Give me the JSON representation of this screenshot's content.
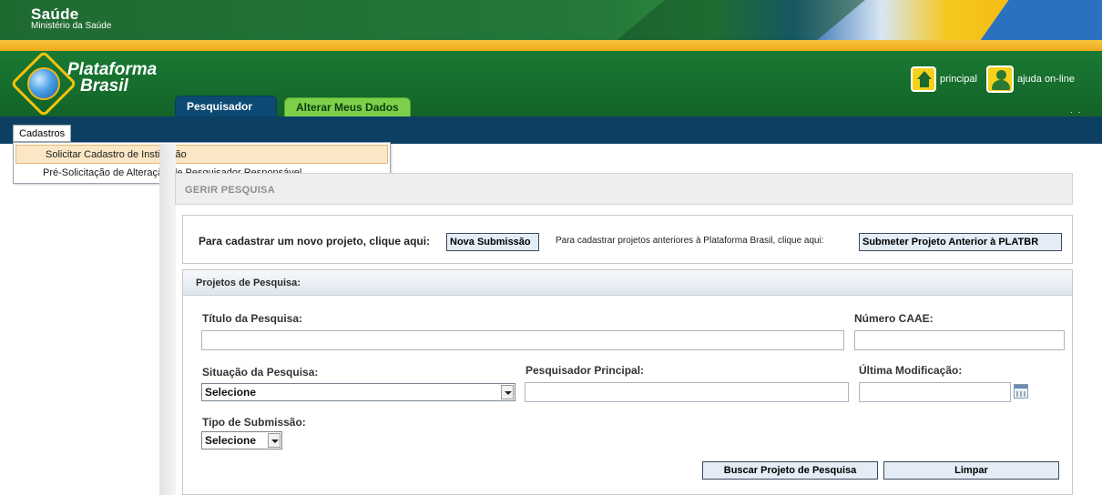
{
  "gov_bar": {
    "title": "Saúde",
    "subtitle": "Ministério da Saúde"
  },
  "logo": {
    "line1": "Plataforma",
    "line2": "Brasil"
  },
  "top_links": {
    "home": "principal",
    "help": "ajuda on-line"
  },
  "tabs": [
    {
      "label": "Pesquisador",
      "active": true
    },
    {
      "label": "Alterar Meus Dados",
      "active": false
    }
  ],
  "menu": {
    "label": "Cadastros",
    "items": [
      {
        "label": "Solicitar Cadastro de Instituição",
        "highlighted": true
      },
      {
        "label": "Pré-Solicitação de Alteração de Pesquisador Responsável",
        "highlighted": false
      }
    ]
  },
  "gerir": {
    "title": "GERIR PESQUISA"
  },
  "submission": {
    "text_new": "Para cadastrar um novo projeto, clique aqui:",
    "btn_new": "Nova Submissão",
    "text_old": "Para cadastrar projetos anteriores à Plataforma Brasil, clique aqui:",
    "btn_old": "Submeter Projeto Anterior à PLATBR"
  },
  "projects": {
    "header": "Projetos de Pesquisa:",
    "fields": {
      "titulo": {
        "label": "Título da Pesquisa:",
        "value": ""
      },
      "caae": {
        "label": "Número CAAE:",
        "value": ""
      },
      "situacao": {
        "label": "Situação da Pesquisa:",
        "value": "Selecione"
      },
      "pesquisador": {
        "label": "Pesquisador Principal:",
        "value": ""
      },
      "modificacao": {
        "label": "Última Modificação:",
        "value": ""
      },
      "tipo": {
        "label": "Tipo de Submissão:",
        "value": "Selecione"
      }
    },
    "buttons": {
      "search": "Buscar Projeto de Pesquisa",
      "clear": "Limpar"
    }
  },
  "colors": {
    "header_green": "#1a7a33",
    "menubar_navy": "#0d3f63",
    "accent_gold": "#f0a91c",
    "tab_active": "#0d4a73",
    "tab_alt": "#7ed04b"
  }
}
